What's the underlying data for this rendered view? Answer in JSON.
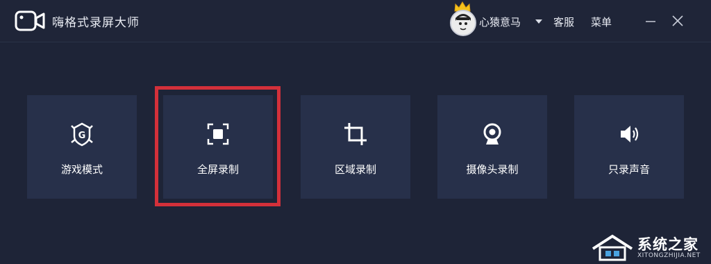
{
  "app": {
    "title": "嗨格式录屏大师"
  },
  "header": {
    "username": "心猿意马",
    "service_label": "客服",
    "menu_label": "菜单"
  },
  "modes": [
    {
      "label": "游戏模式",
      "icon": "game-icon"
    },
    {
      "label": "全屏录制",
      "icon": "fullscreen-icon",
      "highlighted": true
    },
    {
      "label": "区域录制",
      "icon": "crop-icon"
    },
    {
      "label": "摄像头录制",
      "icon": "webcam-icon"
    },
    {
      "label": "只录声音",
      "icon": "speaker-icon"
    }
  ],
  "colors": {
    "background": "#1e2437",
    "card": "#27304a",
    "highlight": "#d3303a"
  },
  "watermark": {
    "title": "系统之家",
    "subtitle": "XITONGZHIJIA.NET"
  }
}
